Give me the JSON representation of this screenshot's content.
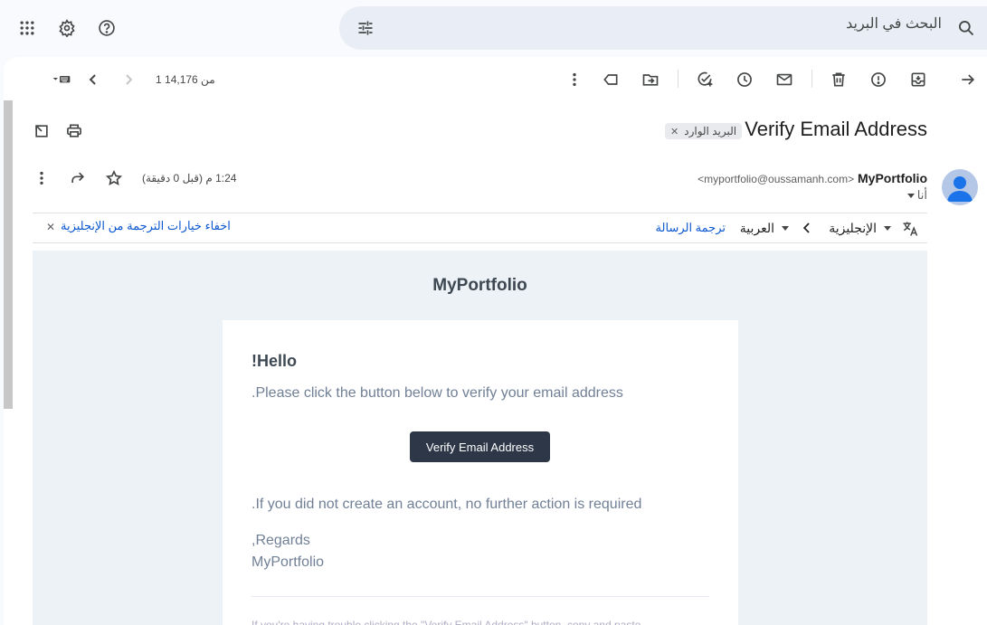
{
  "search": {
    "placeholder": "البحث في البريد"
  },
  "toolbar": {
    "pager": "1 من 14,176"
  },
  "message": {
    "subject": "Verify Email Address",
    "label": "البريد الوارد",
    "sender_name": "MyPortfolio",
    "sender_email": "<myportfolio@oussamanh.com>",
    "recipient": "أنا",
    "time": "1:24 م (قبل 0 دقيقة)"
  },
  "translate": {
    "from_lang": "الإنجليزية",
    "to_lang": "العربية",
    "translate_link": "ترجمة الرسالة",
    "hide_link": "اخفاء خيارات الترجمة من الإنجليزية"
  },
  "email": {
    "brand": "MyPortfolio",
    "greeting": "!Hello",
    "line1": ".Please click the button below to verify your email address",
    "button": "Verify Email Address",
    "line2": ".If you did not create an account, no further action is required",
    "regards": ",Regards",
    "signature": "MyPortfolio",
    "footer": "If you're having trouble clicking the \"Verify Email Address\" button, copy and paste"
  },
  "colors": {
    "accent": "#0b57d0",
    "button_bg": "#2d3748",
    "email_bg": "#edf2f7"
  }
}
